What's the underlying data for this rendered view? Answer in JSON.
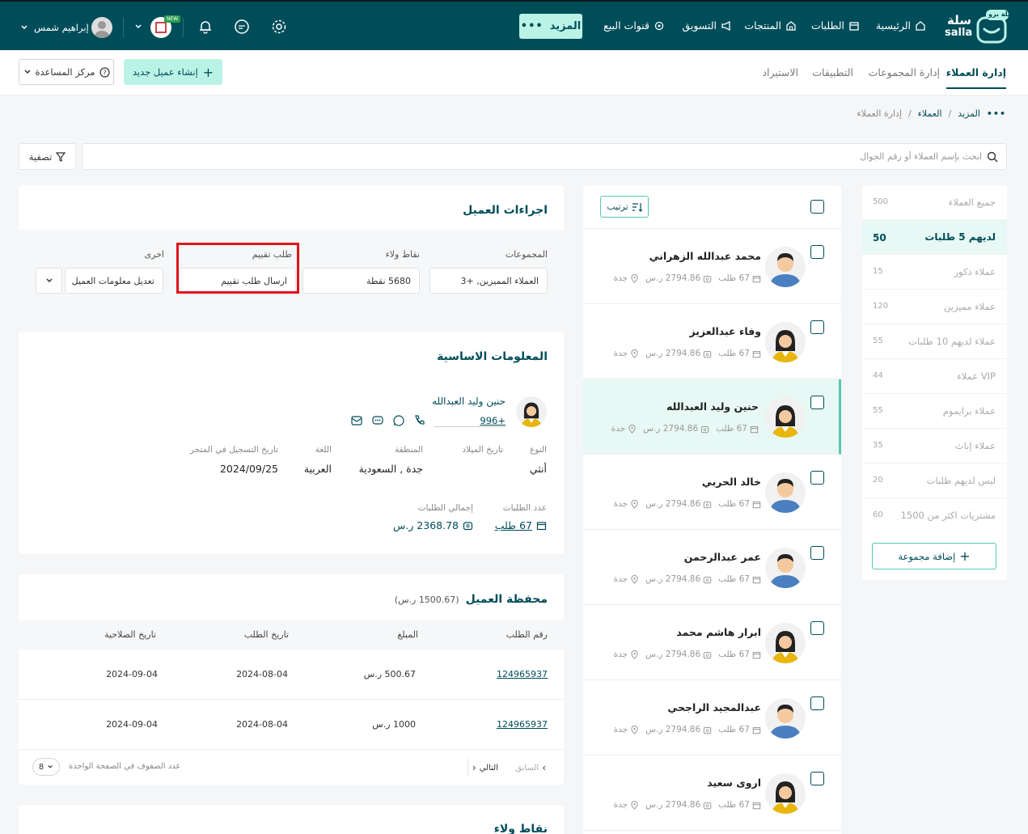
{
  "nav": {
    "logo_ar": "سلة",
    "logo_en": "salla",
    "logo_badge": "سلة برو",
    "items": [
      "الرئيسية",
      "الطلبات",
      "المنتجات",
      "التسويق",
      "قنوات البيع"
    ],
    "more_label": "المزيد",
    "user_name": "إبراهيم شمس",
    "store_badge": "NEW"
  },
  "subheader": {
    "tabs": [
      "إدارة العملاء",
      "إدارة المجموعات",
      "التطبيقات",
      "الاستيراد"
    ],
    "new_customer_label": "إنشاء عميل جديد",
    "help_label": "مركز المساعدة"
  },
  "breadcrumb": [
    "المزيد",
    "العملاء",
    "إدارة العملاء"
  ],
  "breadcrumb_sep": "/",
  "search": {
    "placeholder": "ابحث بإسم العملاء أو رقم الجوال"
  },
  "filter_label": "تصفية",
  "groups": {
    "items": [
      {
        "name": "جميع العملاء",
        "count": "500"
      },
      {
        "name": "لديهم 5 طلبات",
        "count": "50"
      },
      {
        "name": "عملاء ذكور",
        "count": "15"
      },
      {
        "name": "عملاء مميزين",
        "count": "120"
      },
      {
        "name": "عملاء لديهم 10 طلبات",
        "count": "55"
      },
      {
        "name": "عملاء VIP",
        "count": "44"
      },
      {
        "name": "عملاء برايموم",
        "count": "55"
      },
      {
        "name": "عملاء إناث",
        "count": "35"
      },
      {
        "name": "ليس لديهم طلبات",
        "count": "20"
      },
      {
        "name": "مشتريات اكثر من 1500",
        "count": "60"
      }
    ],
    "add_label": "إضافة مجموعة"
  },
  "customer_list": {
    "sort_label": "ترتيب",
    "items": [
      {
        "name": "محمد عبدالله الزهراني",
        "orders": "67 طلب",
        "amount": "2794.86 ر.س",
        "city": "جدة",
        "gender": "m"
      },
      {
        "name": "وفاء عبدالعزيز",
        "orders": "67 طلب",
        "amount": "2794.86 ر.س",
        "city": "جدة",
        "gender": "f"
      },
      {
        "name": "حنين وليد العبدالله",
        "orders": "67 طلب",
        "amount": "2794.86 ر.س",
        "city": "جدة",
        "gender": "f"
      },
      {
        "name": "خالد الحربي",
        "orders": "67 طلب",
        "amount": "2794.86 ر.س",
        "city": "جدة",
        "gender": "m"
      },
      {
        "name": "عمر عبدالرحمن",
        "orders": "67 طلب",
        "amount": "2794.86 ر.س",
        "city": "جدة",
        "gender": "m"
      },
      {
        "name": "ابرار هاشم محمد",
        "orders": "67 طلب",
        "amount": "2794.86 ر.س",
        "city": "جدة",
        "gender": "f"
      },
      {
        "name": "عبدالمجيد الراجحي",
        "orders": "67 طلب",
        "amount": "2794.86 ر.س",
        "city": "جدة",
        "gender": "m"
      },
      {
        "name": "اروى سعيد",
        "orders": "67 طلب",
        "amount": "2794.86 ر.س",
        "city": "جدة",
        "gender": "f"
      }
    ]
  },
  "actions": {
    "title": "اجراءات العميل",
    "groups_label": "المجموعات",
    "groups_value": "العملاء المميزين, +3",
    "points_label": "نقاط ولاء",
    "points_value": "5680 نقطة",
    "rating_label": "طلب تقييم",
    "rating_value": "ارسال طلب تقييم",
    "other_label": "اخرى",
    "other_value": "تعديل معلومات العميل"
  },
  "basic_info": {
    "title": "المعلومات الاساسية",
    "name": "حنين وليد العبدالله",
    "phone": "+996",
    "type_label": "النوع",
    "type_value": "أنثي",
    "birth_label": "تاريخ الميلاد",
    "birth_value": "",
    "region_label": "المنطقة",
    "region_value": "جدة , السعودية",
    "lang_label": "اللغة",
    "lang_value": "العربية",
    "reg_label": "تاريخ التسجيل في المتجر",
    "reg_value": "2024/09/25",
    "orders_label": "عدد الطلبات",
    "orders_value": "67 طلب",
    "total_label": "إجمالي الطلبات",
    "total_value": "2368.78 ر.س"
  },
  "wallet": {
    "title": "محفظة العميل",
    "balance": "(1500.67 ر.س)",
    "columns": [
      "رقم الطلب",
      "المبلغ",
      "تاريخ الطلب",
      "تاريخ الصلاحية"
    ],
    "rows": [
      [
        "124965937",
        "500.67 ر.س",
        "2024-08-04",
        "2024-09-04"
      ],
      [
        "124965937",
        "1000 ر.س",
        "2024-08-04",
        "2024-09-04"
      ]
    ],
    "prev_label": "السابق",
    "next_label": "التالي",
    "rows_per_page_label": "عدد الصفوف في الصفحة الواحدة",
    "rows_per_page_value": "8"
  },
  "loyalty": {
    "title": "نقاط ولاء"
  },
  "colors": {
    "brand": "#004d5a",
    "accent": "#baf3e6",
    "highlight": "#e0141e"
  }
}
